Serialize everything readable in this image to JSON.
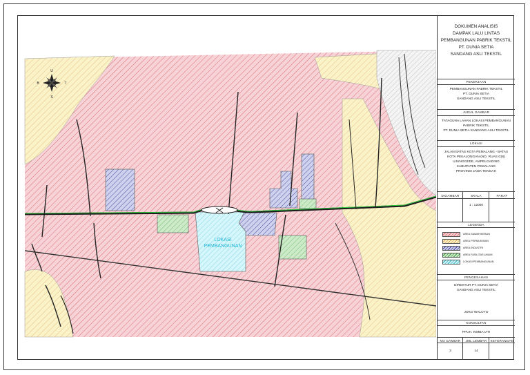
{
  "title_block": {
    "document_title": [
      "DOKUMEN ANALISIS",
      "DAMPAK LALU LINTAS",
      "PEMBANGUNAN PABRIK TEKSTIL",
      "PT. DUNIA SETIA",
      "SANDANG ASLI TEKSTIL"
    ],
    "pekerjaan_header": "PEKERJAAN",
    "pekerjaan": [
      "PEMBANGUNAN PABRIK TEKSTIL",
      "PT. DUNIA SETIA",
      "SANDANG ASLI TEKSTIL"
    ],
    "judul_header": "JUDUL GAMBAR",
    "judul": [
      "TATAGUNA LAHAN LOKASI PEMBANGUNAN",
      "PABRIK TEKSTIL",
      "PT. DUNIA SETIA SANDANG ASLI TEKSTIL"
    ],
    "lokasi_header": "LOKASI",
    "lokasi": [
      "JALAN BATAS KOTA PEMALANG - BATAS",
      "KOTA PEKALONGAN (NO. RUAS 016)",
      "UJUNGGEDE, AMPELGADING",
      "KABUPATEN PEMALANG",
      "PROVINSI JAWA TENGAH"
    ],
    "digambar_header": "DIGAMBAR",
    "skala_header": "SKALA",
    "paraf_header": "PARAF",
    "skala": "1 : 12000",
    "legenda_header": "LEGENDA",
    "pengesahan_header": "PENGESAHAN",
    "pengesahan": [
      "DIREKTUR PT. DUNIA SETIA",
      "SANDANG ASLI TEKSTIL"
    ],
    "signatory": "JOKO WALUYO",
    "konsultan_header": "KONSULTAN",
    "konsultan": "PPUH. KIMBA IATI",
    "no_gambar_header": "NO GAMBAR",
    "jml_lembar_header": "JML LEMBAR",
    "keterangan_header": "KETERANGAN",
    "no_gambar": "3",
    "jml_lembar": "14",
    "keterangan": ""
  },
  "legend": [
    {
      "label": "AREA SAWAH/KEBUN",
      "color": "#e06a6a",
      "fill": "#f7d3d7"
    },
    {
      "label": "AREA PERMUKIMAN",
      "color": "#e0a85a",
      "fill": "#fbf3c8"
    },
    {
      "label": "AREA INDUSTRI",
      "color": "#4040a0",
      "fill": "#cfd2ec"
    },
    {
      "label": "AREA FASILITAS UMUM",
      "color": "#3a9a3a",
      "fill": "#cdebc8"
    },
    {
      "label": "LOKASI PEMBANGUNAN",
      "color": "#3ab5c8",
      "fill": "#cdf4f8"
    }
  ],
  "map": {
    "site_label": [
      "LOKASI",
      "PEMBANGUNAN"
    ],
    "compass": {
      "north": "U",
      "south": "S",
      "west": "B",
      "east": "T"
    },
    "colors": {
      "road_main": "#1a1a1a",
      "road_centerline": "#2ecc40",
      "site_text": "#20b8d8"
    }
  }
}
